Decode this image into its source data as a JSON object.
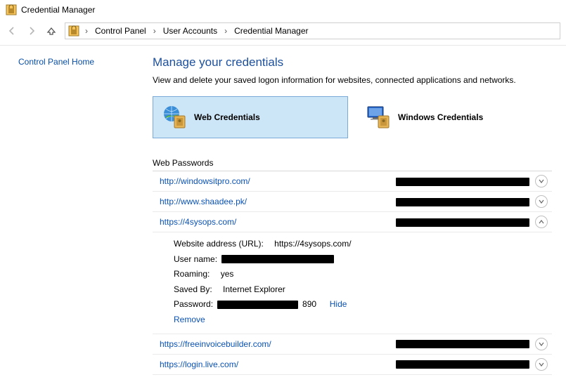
{
  "window": {
    "title": "Credential Manager"
  },
  "breadcrumb": {
    "items": [
      "Control Panel",
      "User Accounts",
      "Credential Manager"
    ]
  },
  "sidebar": {
    "home_link": "Control Panel Home"
  },
  "main": {
    "heading": "Manage your credentials",
    "description": "View and delete your saved logon information for websites, connected applications and networks."
  },
  "cred_types": {
    "web": "Web Credentials",
    "windows": "Windows Credentials"
  },
  "section": {
    "title": "Web Passwords"
  },
  "entries": [
    {
      "url": "http://windowsitpro.com/",
      "expanded": false
    },
    {
      "url": "http://www.shaadee.pk/",
      "expanded": false
    },
    {
      "url": "https://4sysops.com/",
      "expanded": true,
      "detail": {
        "address_label": "Website address (URL):",
        "address_value": "https://4sysops.com/",
        "username_label": "User name:",
        "roaming_label": "Roaming:",
        "roaming_value": "yes",
        "savedby_label": "Saved By:",
        "savedby_value": "Internet Explorer",
        "password_label": "Password:",
        "password_tail": "890",
        "hide_link": "Hide",
        "remove_link": "Remove"
      }
    },
    {
      "url": "https://freeinvoicebuilder.com/",
      "expanded": false
    },
    {
      "url": "https://login.live.com/",
      "expanded": false
    }
  ]
}
